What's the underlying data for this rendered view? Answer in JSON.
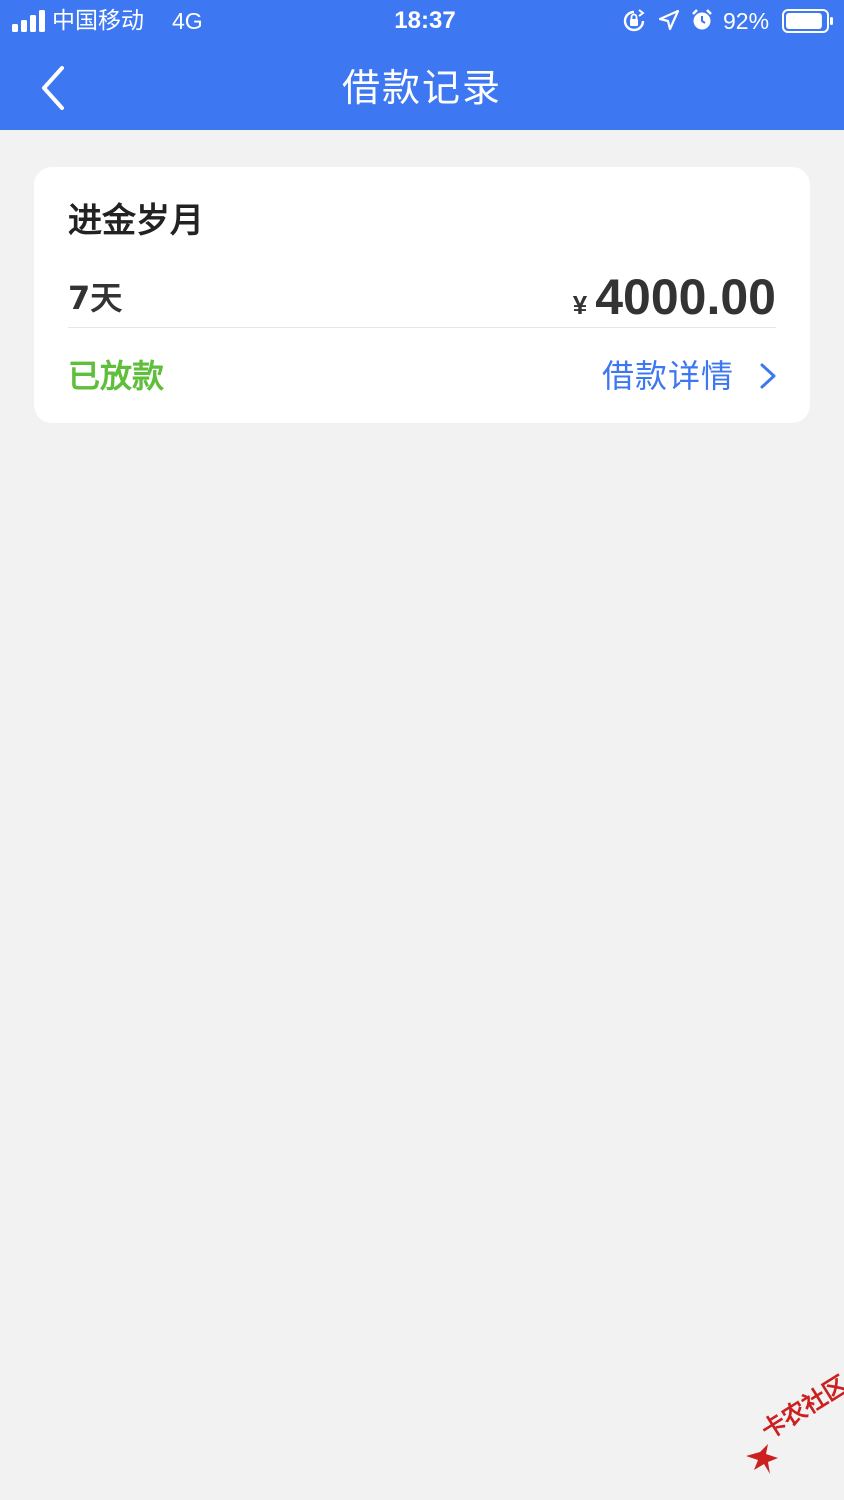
{
  "status_bar": {
    "carrier": "中国移动",
    "network": "4G",
    "time": "18:37",
    "battery_percent": "92%",
    "battery_level": 0.92,
    "icons": [
      "signal-icon",
      "orientation-lock-icon",
      "location-icon",
      "alarm-icon",
      "battery-icon"
    ]
  },
  "nav": {
    "title": "借款记录",
    "back_icon": "chevron-left-icon"
  },
  "loan_record": {
    "product_name": "进金岁月",
    "term": "7天",
    "currency_symbol": "¥",
    "amount": "4000.00",
    "status": "已放款",
    "detail_link": "借款详情",
    "detail_icon": "chevron-right-icon"
  },
  "watermark": {
    "text": "卡农社区"
  },
  "colors": {
    "nav_background": "#3d78f2",
    "page_background": "#f2f2f2",
    "status_green": "#5fbf3a",
    "link_blue": "#3d78f2",
    "watermark_red": "#cc1f1f"
  }
}
